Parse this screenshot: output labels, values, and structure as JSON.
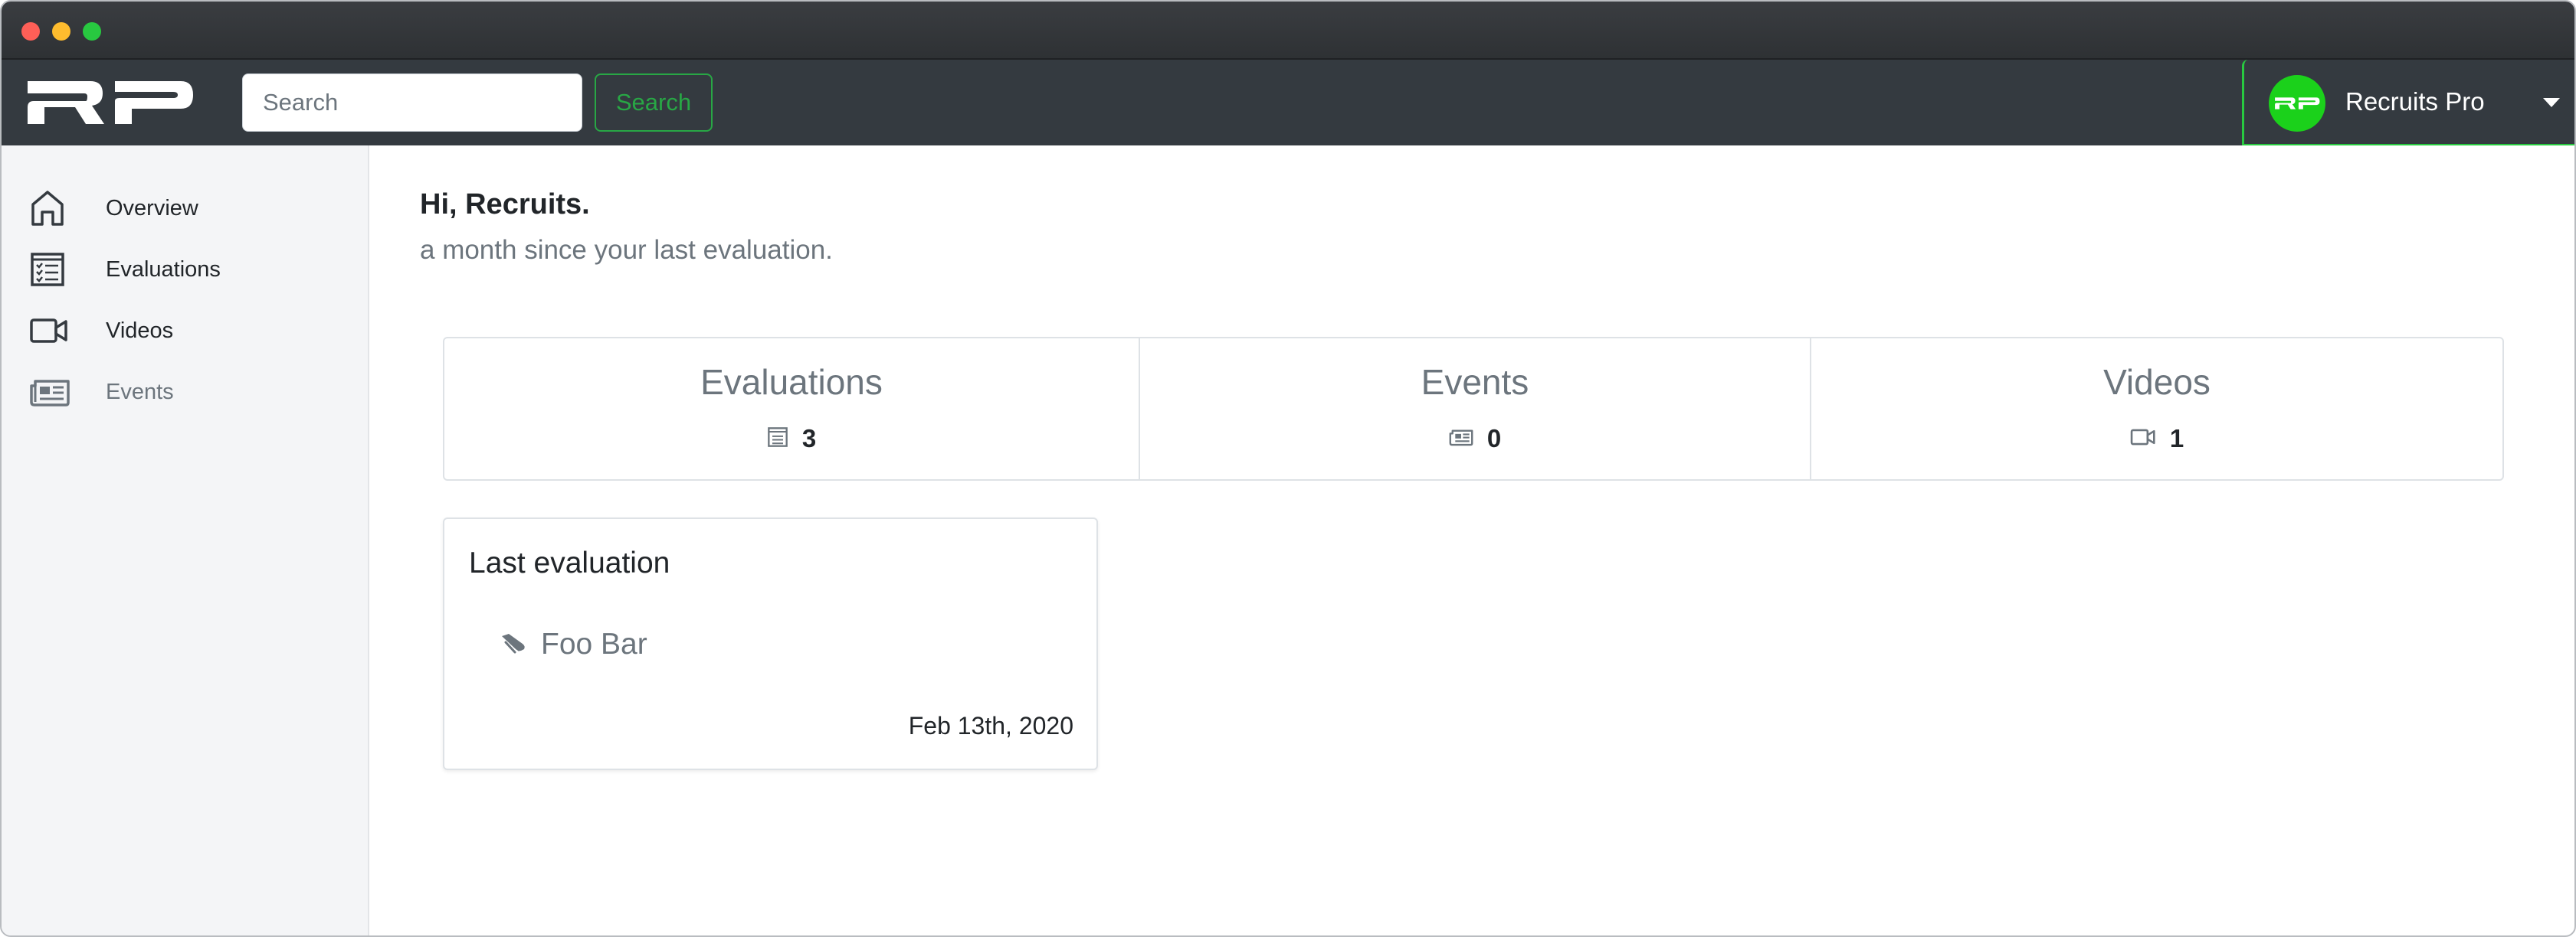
{
  "navbar": {
    "logo_text": "RP",
    "search_placeholder": "Search",
    "search_button": "Search",
    "user_name": "Recruits Pro",
    "avatar_text": "RP"
  },
  "sidebar": {
    "items": [
      {
        "label": "Overview",
        "icon": "home-icon"
      },
      {
        "label": "Evaluations",
        "icon": "evaluations-icon"
      },
      {
        "label": "Videos",
        "icon": "video-camera-icon"
      },
      {
        "label": "Events",
        "icon": "newspaper-icon"
      }
    ]
  },
  "main": {
    "greeting": "Hi, Recruits.",
    "since": "a month since your last evaluation."
  },
  "stats": [
    {
      "title": "Evaluations",
      "count": "3",
      "icon": "evaluations-icon"
    },
    {
      "title": "Events",
      "count": "0",
      "icon": "newspaper-icon"
    },
    {
      "title": "Videos",
      "count": "1",
      "icon": "video-camera-icon"
    }
  ],
  "last_evaluation": {
    "title": "Last evaluation",
    "player": "Foo Bar",
    "player_icon": "cleat-icon",
    "date": "Feb 13th, 2020"
  },
  "colors": {
    "navbar": "#343a40",
    "accent_green": "#28a745",
    "avatar_green": "#1bd11b",
    "sidebar_bg": "#f4f5f7",
    "muted_text": "#6c757d"
  }
}
